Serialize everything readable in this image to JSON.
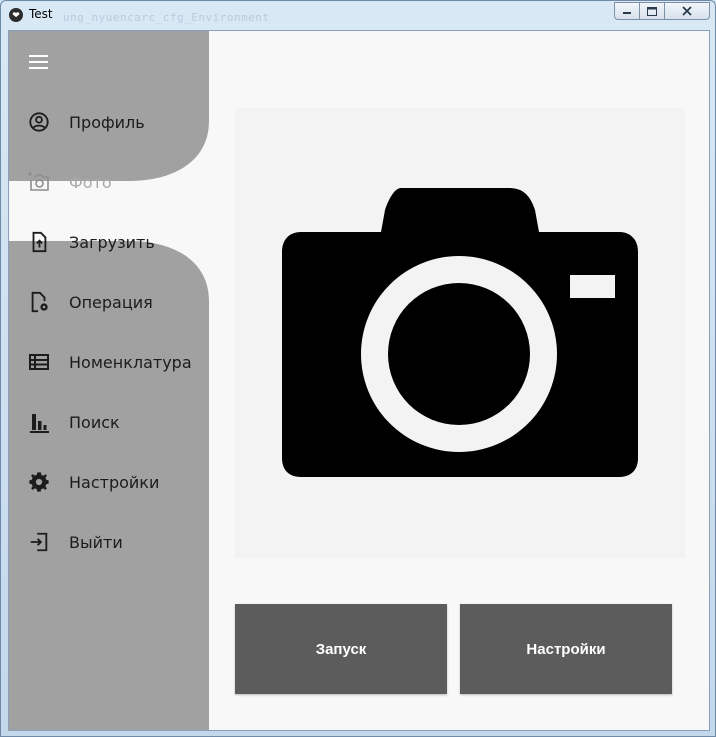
{
  "window": {
    "title": "Test",
    "ghost_text": "ung_nyuencarc_cfg_Environment"
  },
  "sidebar": {
    "items": [
      {
        "label": "Профиль",
        "icon": "profile-icon"
      },
      {
        "label": "Фото",
        "icon": "add-photo-icon",
        "active": true
      },
      {
        "label": "Загрузить",
        "icon": "upload-file-icon"
      },
      {
        "label": "Операция",
        "icon": "file-settings-icon"
      },
      {
        "label": "Номенклатура",
        "icon": "list-icon"
      },
      {
        "label": "Поиск",
        "icon": "bar-chart-icon"
      },
      {
        "label": "Настройки",
        "icon": "gear-icon"
      },
      {
        "label": "Выйти",
        "icon": "exit-icon"
      }
    ]
  },
  "main": {
    "photo_placeholder_icon": "camera-icon",
    "buttons": {
      "start_label": "Запуск",
      "settings_label": "Настройки"
    }
  },
  "colors": {
    "sidebar": "#a1a1a1",
    "background": "#f8f8f8",
    "button": "#5c5c5c",
    "active_label": "#a9a9a9"
  }
}
